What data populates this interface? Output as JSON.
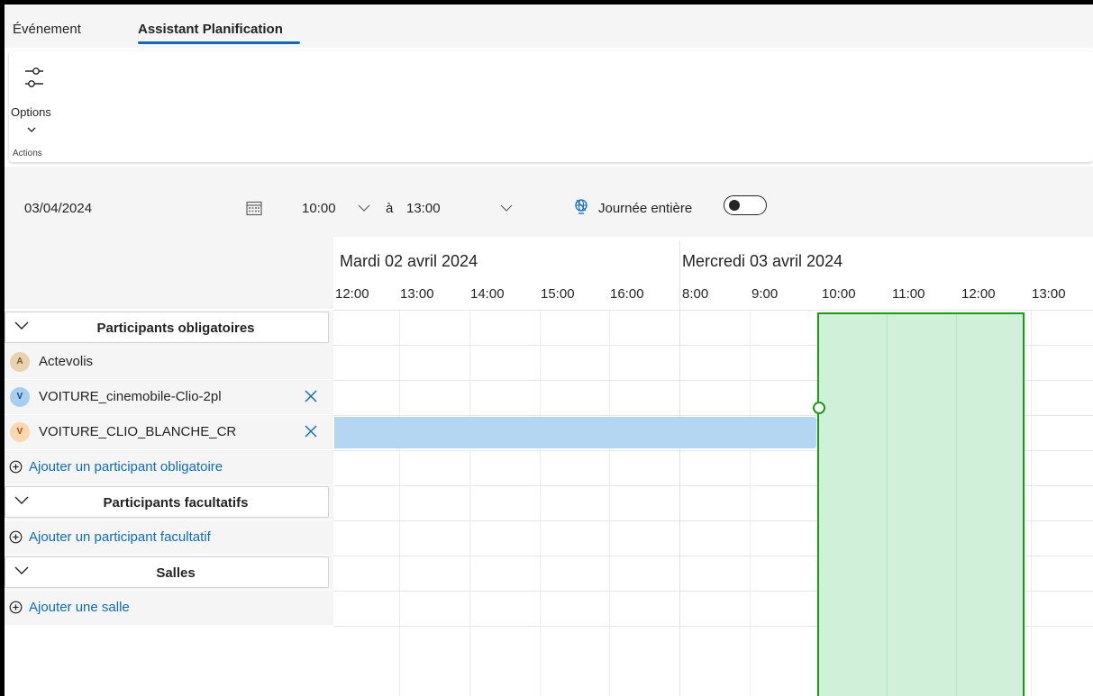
{
  "tabs": {
    "event": "Événement",
    "assistant": "Assistant Planification"
  },
  "ribbon": {
    "options_label": "Options",
    "actions_label": "Actions"
  },
  "datebar": {
    "date": "03/04/2024",
    "start_time": "10:00",
    "to_label": "à",
    "end_time": "13:00",
    "allday_label": "Journée entière",
    "allday_on": false
  },
  "timeline": {
    "days": [
      "Mardi 02 avril 2024",
      "Mercredi 03 avril 2024"
    ],
    "day1_hours": [
      "12:00",
      "13:00",
      "14:00",
      "15:00",
      "16:00"
    ],
    "day2_hours": [
      "8:00",
      "9:00",
      "10:00",
      "11:00",
      "12:00",
      "13:00"
    ],
    "selection": {
      "start": "10:00",
      "end": "13:00"
    }
  },
  "sections": {
    "required": {
      "title": "Participants obligatoires",
      "people": [
        {
          "initial": "A",
          "name": "Actevolis"
        },
        {
          "initial": "V",
          "name": "VOITURE_cinemobile-Clio-2pl"
        },
        {
          "initial": "V",
          "name": "VOITURE_CLIO_BLANCHE_CR"
        }
      ],
      "add_label": "Ajouter un participant obligatoire"
    },
    "optional": {
      "title": "Participants facultatifs",
      "add_label": "Ajouter un participant facultatif"
    },
    "rooms": {
      "title": "Salles",
      "add_label": "Ajouter une salle"
    }
  },
  "colors": {
    "accent": "#0f6cbd",
    "busy": "#b4d6f3",
    "selection_fill": "#d1f0da",
    "selection_border": "#13a10e"
  },
  "icons": [
    "sliders-icon",
    "chevron-down-icon",
    "calendar-icon",
    "timezone-icon",
    "remove-icon",
    "add-circle-icon"
  ]
}
